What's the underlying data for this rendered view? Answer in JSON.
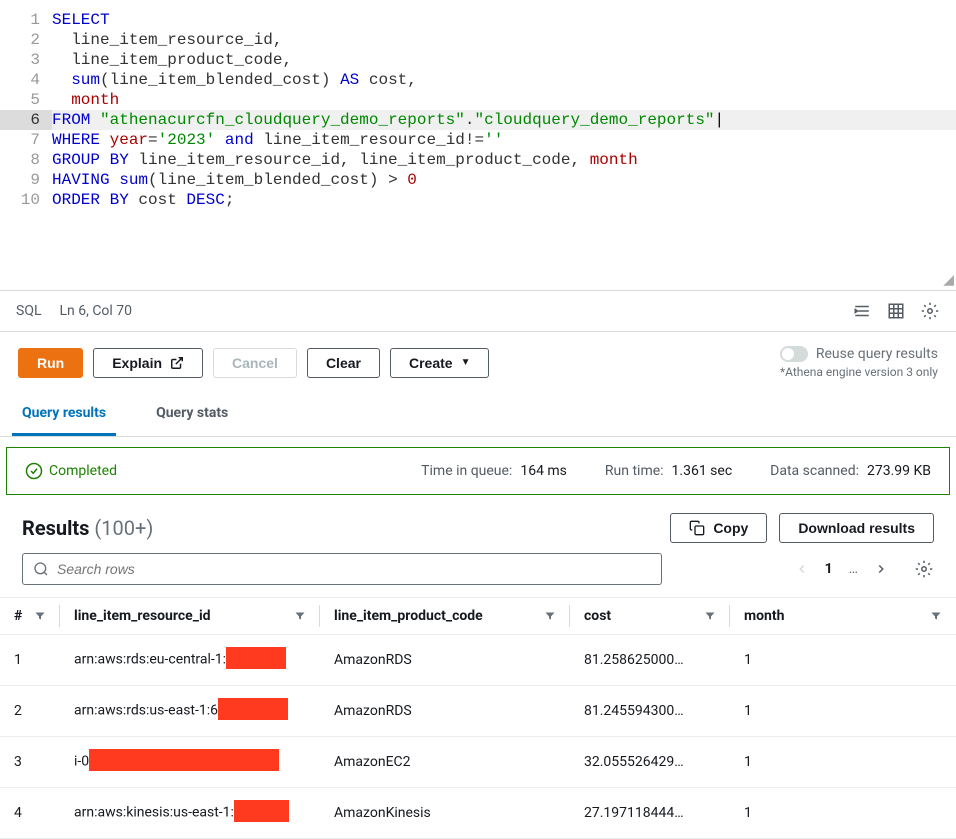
{
  "editor": {
    "lines": [
      {
        "n": 1,
        "segments": [
          {
            "t": "SELECT",
            "c": "kw"
          }
        ]
      },
      {
        "n": 2,
        "segments": [
          {
            "t": "  line_item_resource_id,",
            "c": "id"
          }
        ]
      },
      {
        "n": 3,
        "segments": [
          {
            "t": "  line_item_product_code,",
            "c": "id"
          }
        ]
      },
      {
        "n": 4,
        "segments": [
          {
            "t": "  ",
            "c": "id"
          },
          {
            "t": "sum",
            "c": "fn"
          },
          {
            "t": "(line_item_blended_cost) ",
            "c": "id"
          },
          {
            "t": "AS",
            "c": "kw"
          },
          {
            "t": " cost,",
            "c": "id"
          }
        ]
      },
      {
        "n": 5,
        "segments": [
          {
            "t": "  ",
            "c": "id"
          },
          {
            "t": "month",
            "c": "nm"
          }
        ]
      },
      {
        "n": 6,
        "active": true,
        "segments": [
          {
            "t": "FROM",
            "c": "kw"
          },
          {
            "t": " ",
            "c": "id"
          },
          {
            "t": "\"athenacurcfn_cloudquery_demo_reports\"",
            "c": "str"
          },
          {
            "t": ".",
            "c": "id"
          },
          {
            "t": "\"cloudquery_demo_reports\"",
            "c": "str"
          }
        ]
      },
      {
        "n": 7,
        "segments": [
          {
            "t": "WHERE",
            "c": "kw"
          },
          {
            "t": " ",
            "c": "id"
          },
          {
            "t": "year",
            "c": "nm"
          },
          {
            "t": "=",
            "c": "id"
          },
          {
            "t": "'2023'",
            "c": "str"
          },
          {
            "t": " ",
            "c": "id"
          },
          {
            "t": "and",
            "c": "kw"
          },
          {
            "t": " line_item_resource_id!=",
            "c": "id"
          },
          {
            "t": "''",
            "c": "str"
          }
        ]
      },
      {
        "n": 8,
        "segments": [
          {
            "t": "GROUP BY",
            "c": "kw"
          },
          {
            "t": " line_item_resource_id, line_item_product_code, ",
            "c": "id"
          },
          {
            "t": "month",
            "c": "nm"
          }
        ]
      },
      {
        "n": 9,
        "segments": [
          {
            "t": "HAVING",
            "c": "kw"
          },
          {
            "t": " ",
            "c": "id"
          },
          {
            "t": "sum",
            "c": "fn"
          },
          {
            "t": "(line_item_blended_cost) > ",
            "c": "id"
          },
          {
            "t": "0",
            "c": "nm"
          }
        ]
      },
      {
        "n": 10,
        "segments": [
          {
            "t": "ORDER BY",
            "c": "kw"
          },
          {
            "t": " cost ",
            "c": "id"
          },
          {
            "t": "DESC",
            "c": "kw"
          },
          {
            "t": ";",
            "c": "id"
          }
        ]
      }
    ]
  },
  "status": {
    "lang": "SQL",
    "cursor": "Ln 6, Col 70"
  },
  "toolbar": {
    "run": "Run",
    "explain": "Explain",
    "cancel": "Cancel",
    "clear": "Clear",
    "create": "Create",
    "reuse": "Reuse query results",
    "engine_note": "*Athena engine version 3 only"
  },
  "tabs": {
    "results": "Query results",
    "stats": "Query stats"
  },
  "completion": {
    "status": "Completed",
    "queue_label": "Time in queue:",
    "queue_value": "164 ms",
    "runtime_label": "Run time:",
    "runtime_value": "1.361 sec",
    "scanned_label": "Data scanned:",
    "scanned_value": "273.99 KB"
  },
  "results": {
    "heading": "Results",
    "count": "(100+)",
    "copy": "Copy",
    "download": "Download results",
    "search_placeholder": "Search rows",
    "page": "1",
    "ellipsis": "…",
    "columns": [
      "#",
      "line_item_resource_id",
      "line_item_product_code",
      "cost",
      "month"
    ],
    "rows": [
      {
        "n": "1",
        "rid_prefix": "arn:aws:rds:eu-central-1:",
        "redact_w": 60,
        "prod": "AmazonRDS",
        "cost": "81.258625000…",
        "month": "1"
      },
      {
        "n": "2",
        "rid_prefix": "arn:aws:rds:us-east-1:6",
        "redact_w": 70,
        "prod": "AmazonRDS",
        "cost": "81.245594300…",
        "month": "1"
      },
      {
        "n": "3",
        "rid_prefix": "i-0",
        "redact_w": 190,
        "prod": "AmazonEC2",
        "cost": "32.055526429…",
        "month": "1"
      },
      {
        "n": "4",
        "rid_prefix": "arn:aws:kinesis:us-east-1:",
        "redact_w": 55,
        "prod": "AmazonKinesis",
        "cost": "27.197118444…",
        "month": "1"
      }
    ]
  }
}
